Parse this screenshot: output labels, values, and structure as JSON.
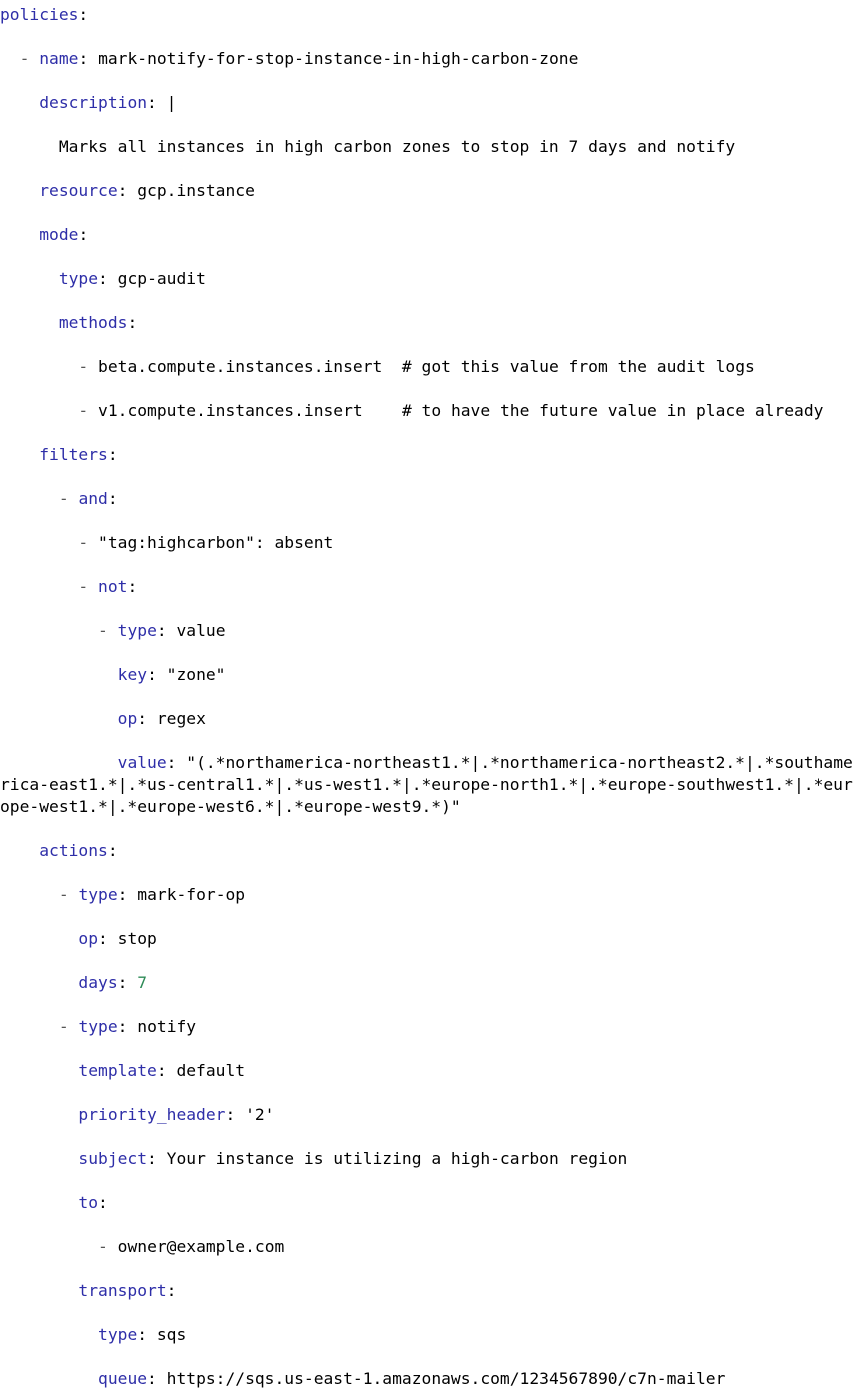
{
  "document": {
    "kind": "yaml-source-listing",
    "language": "YAML",
    "background_color": "#ffffff",
    "colors": {
      "key": "#2E2EA8",
      "string": "#A02020",
      "comment": "#B8651B",
      "number": "#2E8B57",
      "plain": "#000000",
      "dash": "#555555"
    }
  },
  "lines": [
    {
      "id": "l01",
      "tokens": [
        {
          "t": "policies",
          "c": "key"
        },
        {
          "t": ":",
          "c": "punct"
        }
      ]
    },
    {
      "id": "l02",
      "tokens": [
        {
          "t": "  ",
          "c": "plain"
        },
        {
          "t": "-",
          "c": "dash"
        },
        {
          "t": " ",
          "c": "plain"
        },
        {
          "t": "name",
          "c": "key"
        },
        {
          "t": ": ",
          "c": "punct"
        },
        {
          "t": "mark-notify-for-stop-instance-in-high-carbon-zone",
          "c": "plain"
        }
      ]
    },
    {
      "id": "l03",
      "tokens": [
        {
          "t": "    ",
          "c": "plain"
        },
        {
          "t": "description",
          "c": "key"
        },
        {
          "t": ": ",
          "c": "punct"
        },
        {
          "t": "|",
          "c": "plain"
        }
      ]
    },
    {
      "id": "l04",
      "tokens": [
        {
          "t": "      ",
          "c": "plain"
        },
        {
          "t": "Marks all instances in high carbon zones to stop in 7 days and notify",
          "c": "string"
        }
      ]
    },
    {
      "id": "l05",
      "tokens": [
        {
          "t": "    ",
          "c": "plain"
        },
        {
          "t": "resource",
          "c": "key"
        },
        {
          "t": ": ",
          "c": "punct"
        },
        {
          "t": "gcp.instance",
          "c": "plain"
        }
      ]
    },
    {
      "id": "l06",
      "tokens": [
        {
          "t": "    ",
          "c": "plain"
        },
        {
          "t": "mode",
          "c": "key"
        },
        {
          "t": ":",
          "c": "punct"
        }
      ]
    },
    {
      "id": "l07",
      "tokens": [
        {
          "t": "      ",
          "c": "plain"
        },
        {
          "t": "type",
          "c": "key"
        },
        {
          "t": ": ",
          "c": "punct"
        },
        {
          "t": "gcp-audit",
          "c": "plain"
        }
      ]
    },
    {
      "id": "l08",
      "tokens": [
        {
          "t": "      ",
          "c": "plain"
        },
        {
          "t": "methods",
          "c": "key"
        },
        {
          "t": ":",
          "c": "punct"
        }
      ]
    },
    {
      "id": "l09",
      "tokens": [
        {
          "t": "        ",
          "c": "plain"
        },
        {
          "t": "-",
          "c": "dash"
        },
        {
          "t": " ",
          "c": "plain"
        },
        {
          "t": "beta.compute.instances.insert",
          "c": "plain"
        },
        {
          "t": "  ",
          "c": "plain"
        },
        {
          "t": "# got this value from the audit logs",
          "c": "comment"
        }
      ]
    },
    {
      "id": "l10",
      "tokens": [
        {
          "t": "        ",
          "c": "plain"
        },
        {
          "t": "-",
          "c": "dash"
        },
        {
          "t": " ",
          "c": "plain"
        },
        {
          "t": "v1.compute.instances.insert",
          "c": "plain"
        },
        {
          "t": "    ",
          "c": "plain"
        },
        {
          "t": "# to have the future value in place already",
          "c": "comment"
        }
      ]
    },
    {
      "id": "l11",
      "tokens": [
        {
          "t": "    ",
          "c": "plain"
        },
        {
          "t": "filters",
          "c": "key"
        },
        {
          "t": ":",
          "c": "punct"
        }
      ]
    },
    {
      "id": "l12",
      "tokens": [
        {
          "t": "      ",
          "c": "plain"
        },
        {
          "t": "-",
          "c": "dash"
        },
        {
          "t": " ",
          "c": "plain"
        },
        {
          "t": "and",
          "c": "key"
        },
        {
          "t": ":",
          "c": "punct"
        }
      ]
    },
    {
      "id": "l13",
      "tokens": [
        {
          "t": "        ",
          "c": "plain"
        },
        {
          "t": "-",
          "c": "dash"
        },
        {
          "t": " ",
          "c": "plain"
        },
        {
          "t": "\"tag:highcarbon\"",
          "c": "string"
        },
        {
          "t": ": ",
          "c": "punct"
        },
        {
          "t": "absent",
          "c": "plain"
        }
      ]
    },
    {
      "id": "l14",
      "tokens": [
        {
          "t": "        ",
          "c": "plain"
        },
        {
          "t": "-",
          "c": "dash"
        },
        {
          "t": " ",
          "c": "plain"
        },
        {
          "t": "not",
          "c": "key"
        },
        {
          "t": ":",
          "c": "punct"
        }
      ]
    },
    {
      "id": "l15",
      "tokens": [
        {
          "t": "          ",
          "c": "plain"
        },
        {
          "t": "-",
          "c": "dash"
        },
        {
          "t": " ",
          "c": "plain"
        },
        {
          "t": "type",
          "c": "key"
        },
        {
          "t": ": ",
          "c": "punct"
        },
        {
          "t": "value",
          "c": "plain"
        }
      ]
    },
    {
      "id": "l16",
      "tokens": [
        {
          "t": "            ",
          "c": "plain"
        },
        {
          "t": "key",
          "c": "key"
        },
        {
          "t": ": ",
          "c": "punct"
        },
        {
          "t": "\"zone\"",
          "c": "string"
        }
      ]
    },
    {
      "id": "l17",
      "tokens": [
        {
          "t": "            ",
          "c": "plain"
        },
        {
          "t": "op",
          "c": "key"
        },
        {
          "t": ": ",
          "c": "punct"
        },
        {
          "t": "regex",
          "c": "plain"
        }
      ]
    },
    {
      "id": "l18",
      "tokens": [
        {
          "t": "            ",
          "c": "plain"
        },
        {
          "t": "value",
          "c": "key"
        },
        {
          "t": ": ",
          "c": "punct"
        },
        {
          "t": "\"(.*northamerica-northeast1.*|.*northamerica-northeast2.*|.*southamerica-east1.*|.*us-central1.*|.*us-west1.*|.*europe-north1.*|.*europe-southwest1.*|.*europe-west1.*|.*europe-west6.*|.*europe-west9.*)\"",
          "c": "string"
        }
      ]
    },
    {
      "id": "l19",
      "tokens": [
        {
          "t": "    ",
          "c": "plain"
        },
        {
          "t": "actions",
          "c": "key"
        },
        {
          "t": ":",
          "c": "punct"
        }
      ]
    },
    {
      "id": "l20",
      "tokens": [
        {
          "t": "      ",
          "c": "plain"
        },
        {
          "t": "-",
          "c": "dash"
        },
        {
          "t": " ",
          "c": "plain"
        },
        {
          "t": "type",
          "c": "key"
        },
        {
          "t": ": ",
          "c": "punct"
        },
        {
          "t": "mark-for-op",
          "c": "plain"
        }
      ]
    },
    {
      "id": "l21",
      "tokens": [
        {
          "t": "        ",
          "c": "plain"
        },
        {
          "t": "op",
          "c": "key"
        },
        {
          "t": ": ",
          "c": "punct"
        },
        {
          "t": "stop",
          "c": "plain"
        }
      ]
    },
    {
      "id": "l22",
      "tokens": [
        {
          "t": "        ",
          "c": "plain"
        },
        {
          "t": "days",
          "c": "key"
        },
        {
          "t": ": ",
          "c": "punct"
        },
        {
          "t": "7",
          "c": "num"
        }
      ]
    },
    {
      "id": "l23",
      "tokens": [
        {
          "t": "      ",
          "c": "plain"
        },
        {
          "t": "-",
          "c": "dash"
        },
        {
          "t": " ",
          "c": "plain"
        },
        {
          "t": "type",
          "c": "key"
        },
        {
          "t": ": ",
          "c": "punct"
        },
        {
          "t": "notify",
          "c": "plain"
        }
      ]
    },
    {
      "id": "l24",
      "tokens": [
        {
          "t": "        ",
          "c": "plain"
        },
        {
          "t": "template",
          "c": "key"
        },
        {
          "t": ": ",
          "c": "punct"
        },
        {
          "t": "default",
          "c": "plain"
        }
      ]
    },
    {
      "id": "l25",
      "tokens": [
        {
          "t": "        ",
          "c": "plain"
        },
        {
          "t": "priority_header",
          "c": "key"
        },
        {
          "t": ": ",
          "c": "punct"
        },
        {
          "t": "'2'",
          "c": "string"
        }
      ]
    },
    {
      "id": "l26",
      "tokens": [
        {
          "t": "        ",
          "c": "plain"
        },
        {
          "t": "subject",
          "c": "key"
        },
        {
          "t": ": ",
          "c": "punct"
        },
        {
          "t": "Your instance is utilizing a high-carbon region",
          "c": "plain"
        }
      ]
    },
    {
      "id": "l27",
      "tokens": [
        {
          "t": "        ",
          "c": "plain"
        },
        {
          "t": "to",
          "c": "key"
        },
        {
          "t": ":",
          "c": "punct"
        }
      ]
    },
    {
      "id": "l28",
      "tokens": [
        {
          "t": "          ",
          "c": "plain"
        },
        {
          "t": "-",
          "c": "dash"
        },
        {
          "t": " ",
          "c": "plain"
        },
        {
          "t": "owner@example.com",
          "c": "plain"
        }
      ]
    },
    {
      "id": "l29",
      "tokens": [
        {
          "t": "        ",
          "c": "plain"
        },
        {
          "t": "transport",
          "c": "key"
        },
        {
          "t": ":",
          "c": "punct"
        }
      ]
    },
    {
      "id": "l30",
      "tokens": [
        {
          "t": "          ",
          "c": "plain"
        },
        {
          "t": "type",
          "c": "key"
        },
        {
          "t": ": ",
          "c": "punct"
        },
        {
          "t": "sqs",
          "c": "plain"
        }
      ]
    },
    {
      "id": "l31",
      "tokens": [
        {
          "t": "          ",
          "c": "plain"
        },
        {
          "t": "queue",
          "c": "key"
        },
        {
          "t": ": ",
          "c": "punct"
        },
        {
          "t": "https://sqs.us-east-1.amazonaws.com/1234567890/c7n-mailer",
          "c": "plain"
        }
      ]
    }
  ]
}
